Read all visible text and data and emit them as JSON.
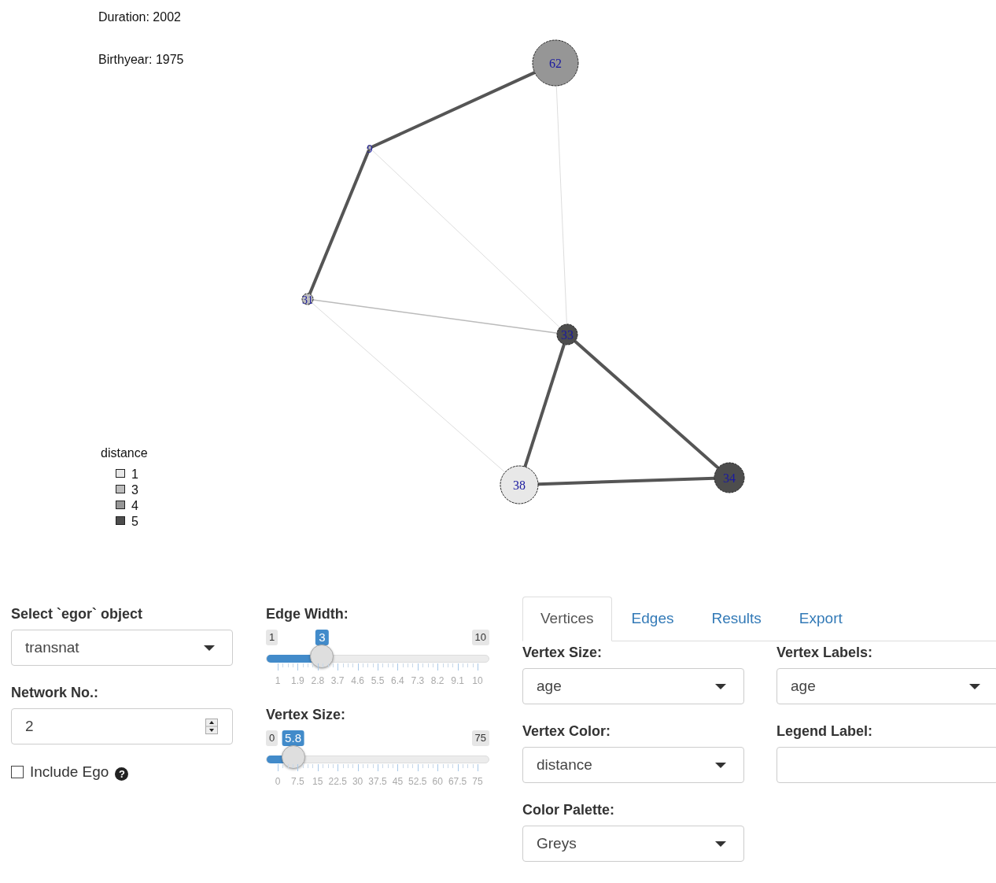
{
  "plot": {
    "annotations": [
      "Duration: 2002",
      "Birthyear: 1975"
    ],
    "vertices": [
      {
        "label": "62",
        "color": "#969696"
      },
      {
        "label": "9",
        "color": "#bdbdbd"
      },
      {
        "label": "31",
        "color": "#bdbdbd"
      },
      {
        "label": "33",
        "color": "#4d4d4d"
      },
      {
        "label": "38",
        "color": "#e8e8e8"
      },
      {
        "label": "34",
        "color": "#4d4d4d"
      }
    ],
    "edges": [
      {
        "kind": "strong"
      },
      {
        "kind": "strong"
      },
      {
        "kind": "weak"
      },
      {
        "kind": "weak"
      },
      {
        "kind": "medium"
      },
      {
        "kind": "weak"
      },
      {
        "kind": "strong"
      },
      {
        "kind": "strong"
      },
      {
        "kind": "strong"
      }
    ],
    "legend": {
      "title": "distance",
      "items": [
        {
          "label": "1",
          "color": "#e8e8e8"
        },
        {
          "label": "3",
          "color": "#bdbdbd"
        },
        {
          "label": "4",
          "color": "#969696"
        },
        {
          "label": "5",
          "color": "#4d4d4d"
        }
      ]
    }
  },
  "sidebar": {
    "object_select": {
      "label": "Select `egor` object",
      "value": "transnat"
    },
    "network": {
      "label": "Network No.:",
      "value": "2"
    },
    "include_ego": {
      "label": "Include Ego",
      "checked": false,
      "help": "?"
    }
  },
  "sliders": [
    {
      "label": "Edge Width:",
      "min": "1",
      "max": "10",
      "value": "3",
      "level": 0.222,
      "ticks": [
        "1",
        "1.9",
        "2.8",
        "3.7",
        "4.6",
        "5.5",
        "6.4",
        "7.3",
        "8.2",
        "9.1",
        "10"
      ]
    },
    {
      "label": "Vertex Size:",
      "min": "0",
      "max": "75",
      "value": "5.8",
      "level": 0.077,
      "ticks": [
        "0",
        "7.5",
        "15",
        "22.5",
        "30",
        "37.5",
        "45",
        "52.5",
        "60",
        "67.5",
        "75"
      ]
    }
  ],
  "tabs": [
    {
      "label": "Vertices",
      "selected": true
    },
    {
      "label": "Edges",
      "selected": false
    },
    {
      "label": "Results",
      "selected": false
    },
    {
      "label": "Export",
      "selected": false
    }
  ],
  "fields": [
    {
      "label": "Vertex Size:",
      "kind": "select",
      "value": "age"
    },
    {
      "label": "Vertex Labels:",
      "kind": "select",
      "value": "age"
    },
    {
      "label": "Vertex Color:",
      "kind": "select",
      "value": "distance"
    },
    {
      "label": "Legend Label:",
      "kind": "text"
    },
    {
      "label": "Color Palette:",
      "kind": "select",
      "value": "Greys"
    }
  ]
}
